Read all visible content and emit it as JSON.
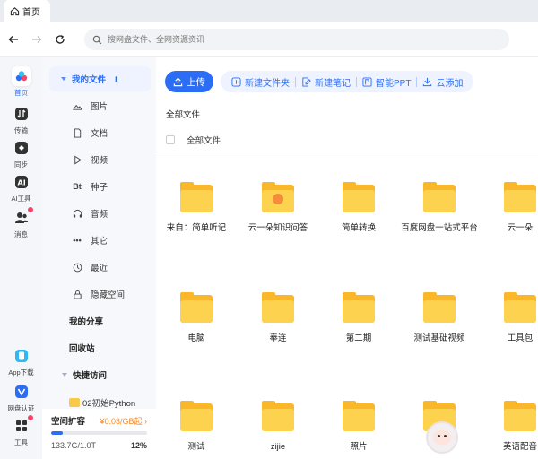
{
  "tab": {
    "label": "首页"
  },
  "search": {
    "placeholder": "搜网盘文件、全网资源资讯"
  },
  "rail": [
    {
      "label": "首页",
      "icon": "home-cloud-icon",
      "active": true
    },
    {
      "label": "传输",
      "icon": "transfer-icon"
    },
    {
      "label": "同步",
      "icon": "sync-icon"
    },
    {
      "label": "AI工具",
      "icon": "ai-icon"
    },
    {
      "label": "消息",
      "icon": "message-icon",
      "dot": true
    },
    {
      "label": "App下载",
      "icon": "app-download-icon"
    },
    {
      "label": "网盘认证",
      "icon": "verify-icon"
    },
    {
      "label": "工具",
      "icon": "tools-icon",
      "dot": true
    }
  ],
  "sidenav": {
    "root": "我的文件",
    "items": [
      "图片",
      "文档",
      "视频",
      "种子",
      "音频",
      "其它",
      "最近",
      "隐藏空间"
    ],
    "share": "我的分享",
    "recycle": "回收站",
    "quick": "快捷访问",
    "quick_folder": "02初始Python"
  },
  "storage": {
    "title": "空间扩容",
    "price": "¥0.03/GB起 ›",
    "used": "133.7G/1.0T",
    "percent": "12%",
    "percent_value": 12
  },
  "toolbar": {
    "upload": "上传",
    "new_folder": "新建文件夹",
    "new_note": "新建笔记",
    "ppt": "智能PPT",
    "cloud_add": "云添加"
  },
  "breadcrumb": "全部文件",
  "list_header": "全部文件",
  "files": [
    {
      "name": "来自：简单听记"
    },
    {
      "name": "云一朵知识问答",
      "badge": true
    },
    {
      "name": "简单转换"
    },
    {
      "name": "百度网盘一站式平台"
    },
    {
      "name": "云一朵"
    },
    {
      "name": "电脑"
    },
    {
      "name": "奉连"
    },
    {
      "name": "第二期"
    },
    {
      "name": "测试基础视频"
    },
    {
      "name": "工具包"
    },
    {
      "name": "测试"
    },
    {
      "name": "zijie"
    },
    {
      "name": "照片"
    },
    {
      "name": ""
    },
    {
      "name": "英语配音"
    }
  ]
}
